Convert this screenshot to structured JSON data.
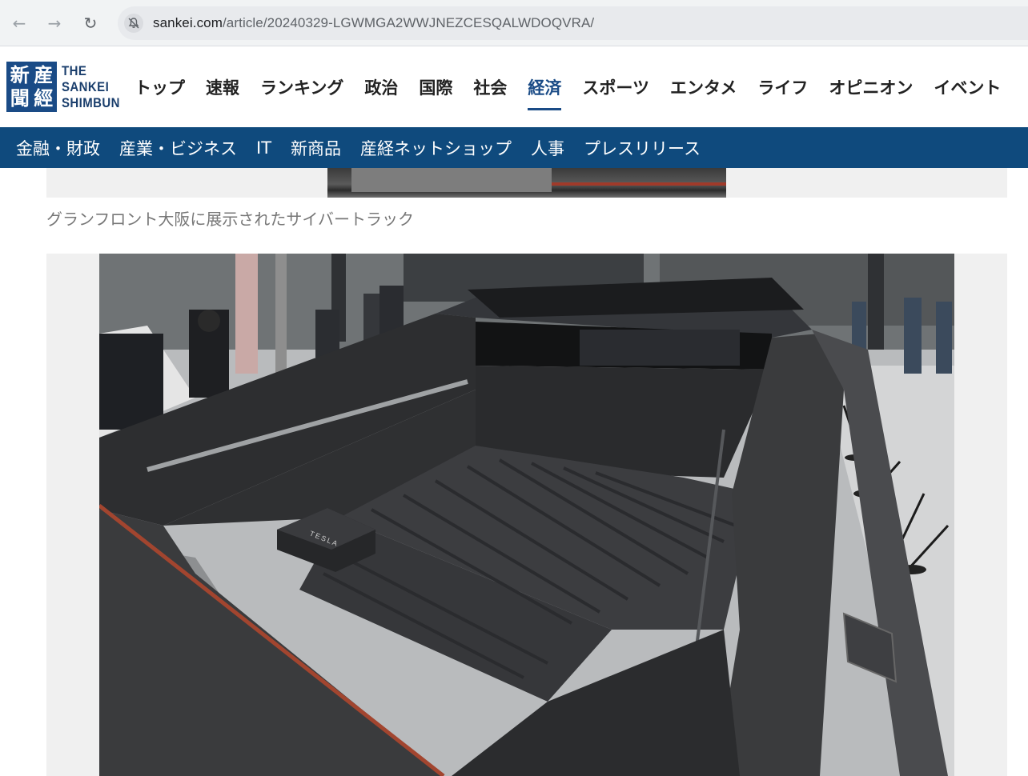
{
  "browser": {
    "url_domain": "sankei.com",
    "url_path": "/article/20240329-LGWMGA2WWJNEZCESQALWDOQVRA/",
    "back_icon": "arrow-left",
    "forward_icon": "arrow-right",
    "reload_icon": "reload",
    "security_icon": "not-secure-bell"
  },
  "site": {
    "logo_kanji": [
      "産",
      "經",
      "新",
      "聞"
    ],
    "logo_line1": "THE",
    "logo_line2": "SANKEI",
    "logo_line3": "SHIMBUN",
    "brand_color": "#1a4b86",
    "main_nav": [
      "トップ",
      "速報",
      "ランキング",
      "政治",
      "国際",
      "社会",
      "経済",
      "スポーツ",
      "エンタメ",
      "ライフ",
      "オピニオン",
      "イベント"
    ],
    "active_nav": "経済",
    "sub_nav": [
      "金融・財政",
      "産業・ビジネス",
      "IT",
      "新商品",
      "産経ネットショップ",
      "人事",
      "プレスリリース"
    ],
    "sub_nav_color": "#0f4a7d"
  },
  "article": {
    "caption": "グランフロント大阪に展示されたサイバートラック",
    "photo_bag_text": "TESLA"
  }
}
